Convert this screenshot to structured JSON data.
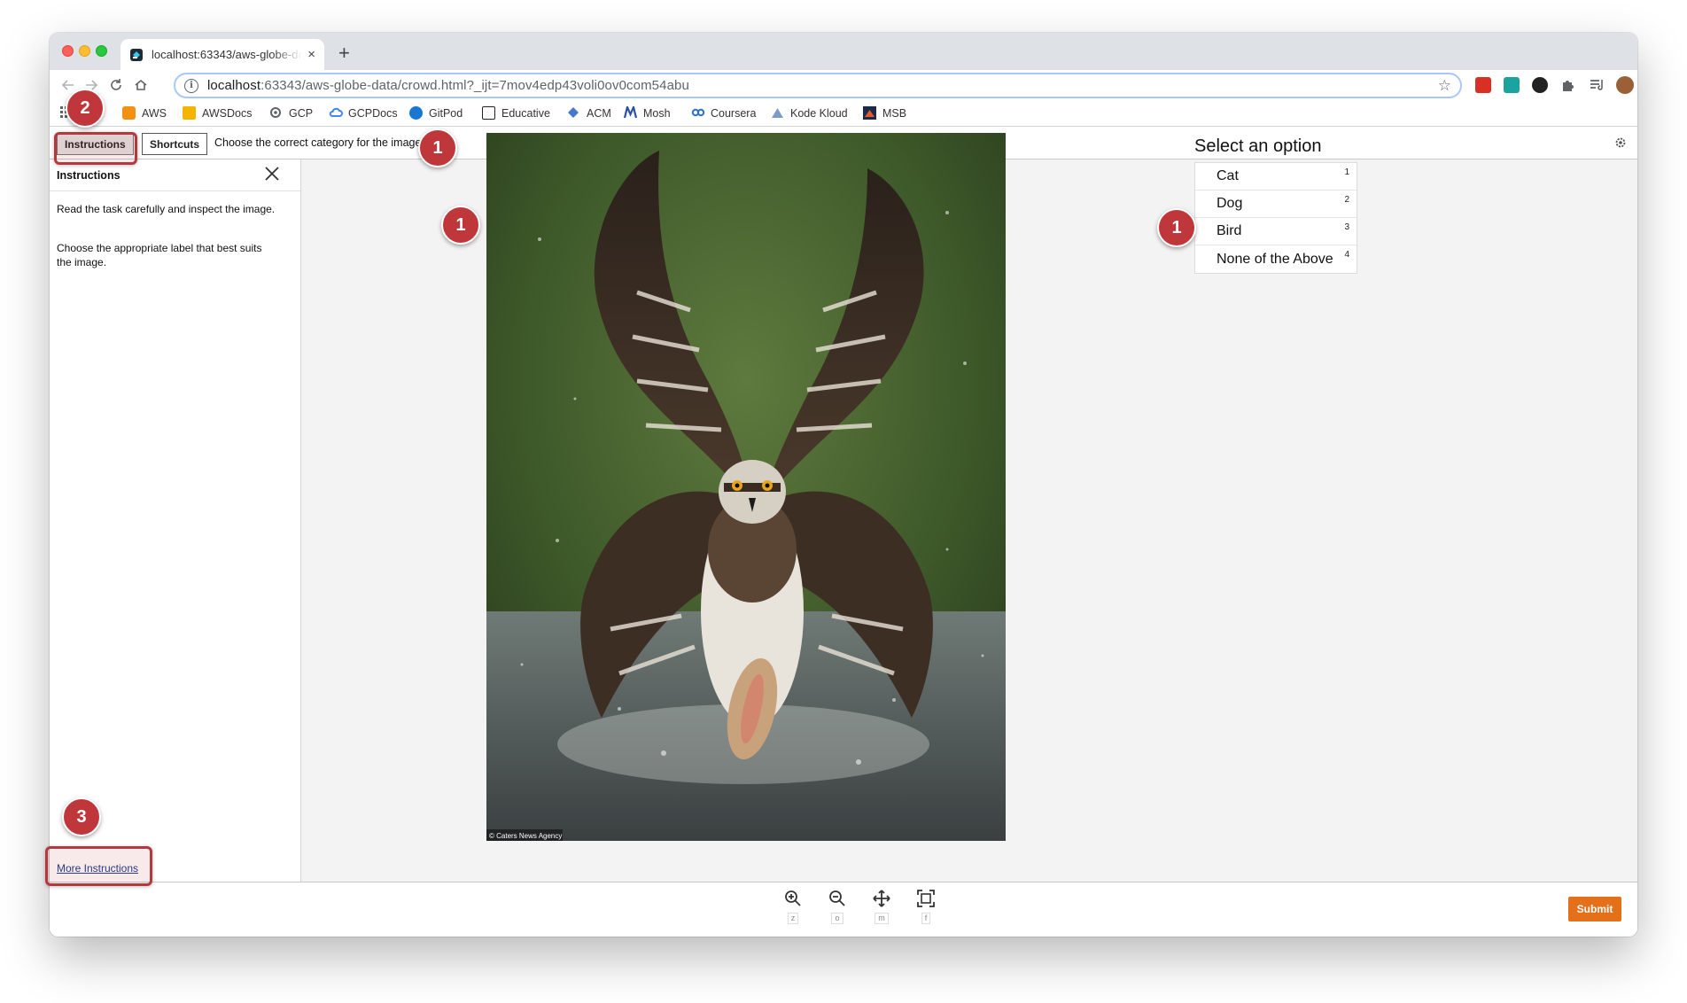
{
  "browser": {
    "tab_title": "localhost:63343/aws-globe-data/crowd.html?_ijt=7mov4edp43voli0ov0com54abu",
    "tab_close": "×",
    "new_tab": "+",
    "url_host": "localhost",
    "url_rest": ":63343/aws-globe-data/crowd.html?_ijt=7mov4edp43voli0ov0com54abu",
    "info": "i"
  },
  "bookmarks": [
    {
      "label": "AWS",
      "icon": "aws-icon",
      "color": "#f29111"
    },
    {
      "label": "AWSDocs",
      "icon": "folder-icon",
      "color": "#f4b400"
    },
    {
      "label": "GCP",
      "icon": "gear-icon",
      "color": "#5f6368"
    },
    {
      "label": "GCPDocs",
      "icon": "cloud-icon",
      "color": "#4285f4"
    },
    {
      "label": "GitPod",
      "icon": "gitpod-icon",
      "color": "#1976d2"
    },
    {
      "label": "Educative",
      "icon": "terminal-icon",
      "color": "#222222"
    },
    {
      "label": "ACM",
      "icon": "diamond-icon",
      "color": "#4a78c8"
    },
    {
      "label": "Mosh",
      "icon": "mosh-icon",
      "color": "#2a4fa8"
    },
    {
      "label": "Coursera",
      "icon": "coursera-icon",
      "color": "#2a73cc"
    },
    {
      "label": "Kode Kloud",
      "icon": "kodekloud-icon",
      "color": "#7b9bc9"
    },
    {
      "label": "MSB",
      "icon": "msb-icon",
      "color": "#c0392b"
    }
  ],
  "task": {
    "instructions_tab": "Instructions",
    "shortcuts_tab": "Shortcuts",
    "prompt": "Choose the correct category for the image."
  },
  "sidebar": {
    "title": "Instructions",
    "paragraphs": [
      "Read the task carefully and inspect the image.",
      "Choose the appropriate label that best suits the image."
    ],
    "more_link": "More Instructions"
  },
  "image": {
    "subject": "osprey catching a fish in water",
    "credit": "© Caters News Agency"
  },
  "options": {
    "title": "Select an option",
    "items": [
      {
        "label": "Cat",
        "key": "1"
      },
      {
        "label": "Dog",
        "key": "2"
      },
      {
        "label": "Bird",
        "key": "3"
      },
      {
        "label": "None of the Above",
        "key": "4"
      }
    ]
  },
  "tools": [
    {
      "name": "zoom-in-icon",
      "key": "z"
    },
    {
      "name": "zoom-out-icon",
      "key": "o"
    },
    {
      "name": "move-icon",
      "key": "m"
    },
    {
      "name": "fit-icon",
      "key": "f"
    }
  ],
  "submit_label": "Submit",
  "callouts": {
    "prompt": "1",
    "image": "1",
    "options": "1",
    "instructions": "2",
    "more": "3"
  },
  "colors": {
    "callout": "#c0373b",
    "submit": "#e4711a",
    "link": "#1a3e8c"
  }
}
